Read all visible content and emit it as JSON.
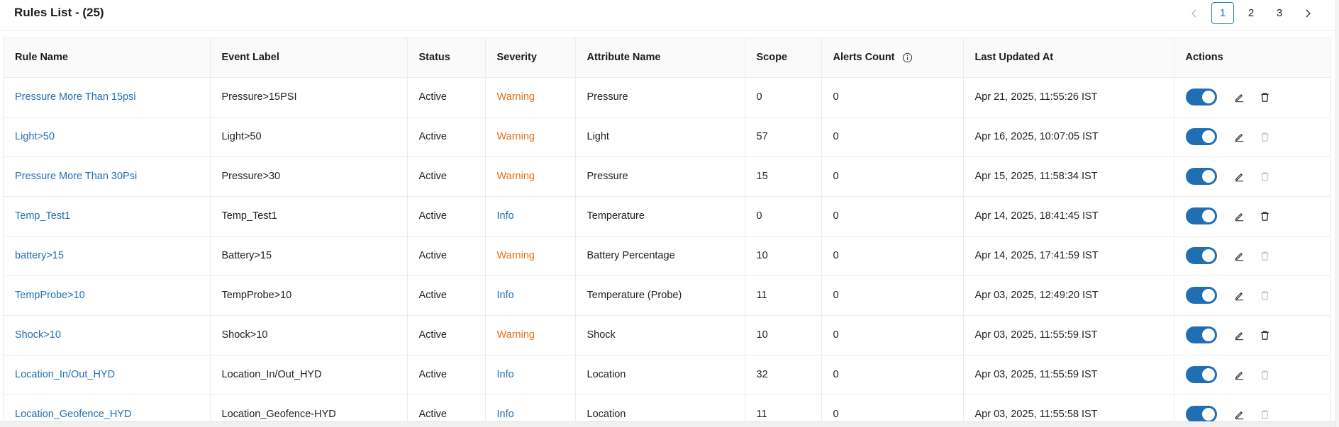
{
  "page": {
    "title": "Rules List - (25)"
  },
  "pagination": {
    "prev_icon": "chevron-left-icon",
    "next_icon": "chevron-right-icon",
    "pages": [
      "1",
      "2",
      "3"
    ],
    "active_page": "1"
  },
  "table": {
    "headers": {
      "rule_name": "Rule Name",
      "event_label": "Event Label",
      "status": "Status",
      "severity": "Severity",
      "attribute_name": "Attribute Name",
      "scope": "Scope",
      "alerts_count": "Alerts Count",
      "last_updated": "Last Updated At",
      "actions": "Actions"
    },
    "rows": [
      {
        "rule_name": "Pressure More Than 15psi",
        "event_label": "Pressure>15PSI",
        "status": "Active",
        "severity": "Warning",
        "attribute_name": "Pressure",
        "scope": "0",
        "alerts_count": "0",
        "last_updated": "Apr 21, 2025, 11:55:26 IST",
        "enabled": true,
        "delete_enabled": true
      },
      {
        "rule_name": "Light>50",
        "event_label": "Light>50",
        "status": "Active",
        "severity": "Warning",
        "attribute_name": "Light",
        "scope": "57",
        "alerts_count": "0",
        "last_updated": "Apr 16, 2025, 10:07:05 IST",
        "enabled": true,
        "delete_enabled": false
      },
      {
        "rule_name": "Pressure More Than 30Psi",
        "event_label": "Pressure>30",
        "status": "Active",
        "severity": "Warning",
        "attribute_name": "Pressure",
        "scope": "15",
        "alerts_count": "0",
        "last_updated": "Apr 15, 2025, 11:58:34 IST",
        "enabled": true,
        "delete_enabled": false
      },
      {
        "rule_name": "Temp_Test1",
        "event_label": "Temp_Test1",
        "status": "Active",
        "severity": "Info",
        "attribute_name": "Temperature",
        "scope": "0",
        "alerts_count": "0",
        "last_updated": "Apr 14, 2025, 18:41:45 IST",
        "enabled": true,
        "delete_enabled": true
      },
      {
        "rule_name": "battery>15",
        "event_label": "Battery>15",
        "status": "Active",
        "severity": "Warning",
        "attribute_name": "Battery Percentage",
        "scope": "10",
        "alerts_count": "0",
        "last_updated": "Apr 14, 2025, 17:41:59 IST",
        "enabled": true,
        "delete_enabled": false
      },
      {
        "rule_name": "TempProbe>10",
        "event_label": "TempProbe>10",
        "status": "Active",
        "severity": "Info",
        "attribute_name": "Temperature (Probe)",
        "scope": "11",
        "alerts_count": "0",
        "last_updated": "Apr 03, 2025, 12:49:20 IST",
        "enabled": true,
        "delete_enabled": false
      },
      {
        "rule_name": "Shock>10",
        "event_label": "Shock>10",
        "status": "Active",
        "severity": "Warning",
        "attribute_name": "Shock",
        "scope": "10",
        "alerts_count": "0",
        "last_updated": "Apr 03, 2025, 11:55:59 IST",
        "enabled": true,
        "delete_enabled": true
      },
      {
        "rule_name": "Location_In/Out_HYD",
        "event_label": "Location_In/Out_HYD",
        "status": "Active",
        "severity": "Info",
        "attribute_name": "Location",
        "scope": "32",
        "alerts_count": "0",
        "last_updated": "Apr 03, 2025, 11:55:59 IST",
        "enabled": true,
        "delete_enabled": false
      },
      {
        "rule_name": "Location_Geofence_HYD",
        "event_label": "Location_Geofence-HYD",
        "status": "Active",
        "severity": "Info",
        "attribute_name": "Location",
        "scope": "11",
        "alerts_count": "0",
        "last_updated": "Apr 03, 2025, 11:55:58 IST",
        "enabled": true,
        "delete_enabled": false
      }
    ]
  },
  "colors": {
    "link": "#2370b4",
    "warning": "#e0741a",
    "info": "#2370b4",
    "toggle_on": "#1f6fb2"
  }
}
